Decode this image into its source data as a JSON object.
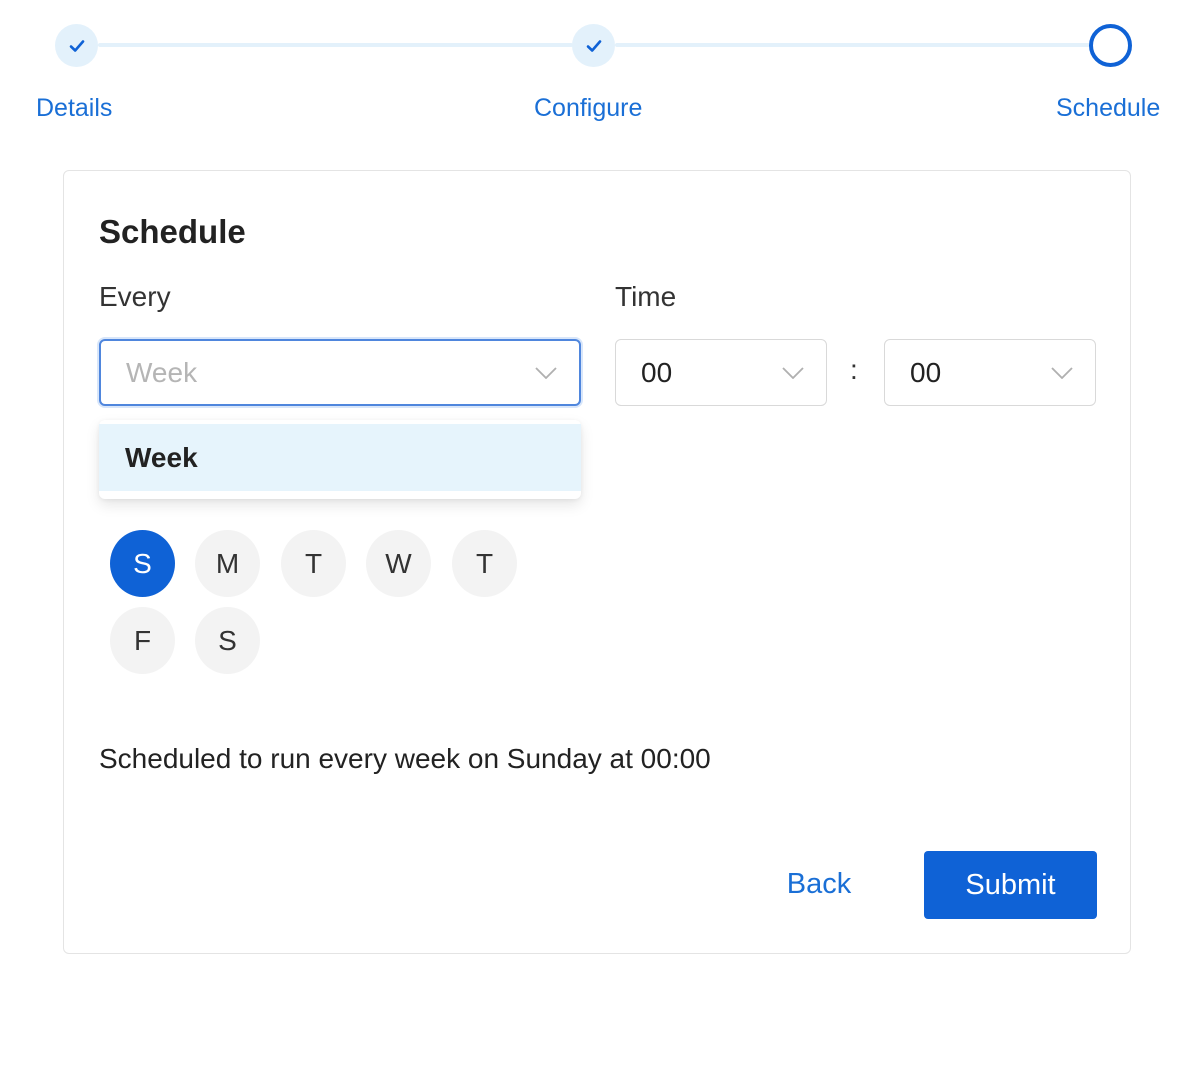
{
  "stepper": {
    "steps": [
      {
        "label": "Details",
        "status": "complete",
        "icon": "check-icon"
      },
      {
        "label": "Configure",
        "status": "complete",
        "icon": "check-icon"
      },
      {
        "label": "Schedule",
        "status": "current",
        "icon": "ring-icon"
      }
    ]
  },
  "schedule": {
    "title": "Schedule",
    "every_label": "Every",
    "every_value": "Week",
    "time_label": "Time",
    "hour_value": "00",
    "minute_value": "00",
    "time_separator": ":",
    "dropdown_options": [
      "Week"
    ],
    "days": [
      {
        "label": "S",
        "selected": true
      },
      {
        "label": "M",
        "selected": false
      },
      {
        "label": "T",
        "selected": false
      },
      {
        "label": "W",
        "selected": false
      },
      {
        "label": "T",
        "selected": false
      },
      {
        "label": "F",
        "selected": false
      },
      {
        "label": "S",
        "selected": false
      }
    ],
    "summary": "Scheduled to run every week on Sunday at 00:00"
  },
  "actions": {
    "back_label": "Back",
    "submit_label": "Submit"
  },
  "colors": {
    "primary": "#0f62d6",
    "link": "#1a6fd6",
    "step_track": "#e3f1fb",
    "option_highlight": "#e6f4fc",
    "day_inactive": "#f3f3f3"
  }
}
